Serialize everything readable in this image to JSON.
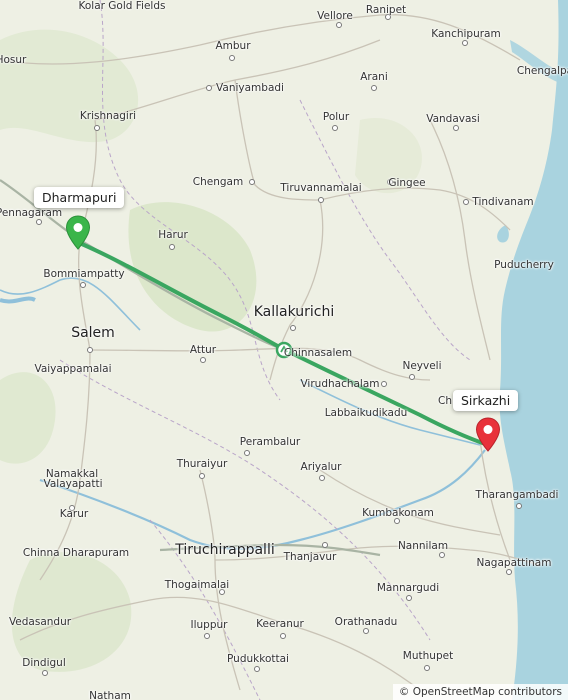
{
  "route": {
    "start": {
      "name": "Dharmapuri",
      "color": "#3ab54a"
    },
    "end": {
      "name": "Sirkazhi",
      "color": "#e8313a"
    },
    "line_color": "#3aa660"
  },
  "places": [
    {
      "id": "kolar-gold-fields",
      "name": "Kolar Gold Fields"
    },
    {
      "id": "vellore",
      "name": "Vellore"
    },
    {
      "id": "ranipet",
      "name": "Ranipet"
    },
    {
      "id": "kanchipuram",
      "name": "Kanchipuram"
    },
    {
      "id": "chengalpattu",
      "name": "Chengalpa"
    },
    {
      "id": "hosur",
      "name": "Hosur"
    },
    {
      "id": "ambur",
      "name": "Ambur"
    },
    {
      "id": "arani",
      "name": "Arani"
    },
    {
      "id": "vaniyambadi",
      "name": "Vaniyambadi"
    },
    {
      "id": "krishnagiri",
      "name": "Krishnagiri"
    },
    {
      "id": "polur",
      "name": "Polur"
    },
    {
      "id": "vandavasi",
      "name": "Vandavasi"
    },
    {
      "id": "chengam",
      "name": "Chengam"
    },
    {
      "id": "tiruvannamalai",
      "name": "Tiruvannamalai"
    },
    {
      "id": "gingee",
      "name": "Gingee"
    },
    {
      "id": "tindivanam",
      "name": "Tindivanam"
    },
    {
      "id": "pennagaram",
      "name": "Pennagaram"
    },
    {
      "id": "harur",
      "name": "Harur"
    },
    {
      "id": "puducherry",
      "name": "Puducherry"
    },
    {
      "id": "bommiampatty",
      "name": "Bommiampatty"
    },
    {
      "id": "kallakurichi",
      "name": "Kallakurichi"
    },
    {
      "id": "salem",
      "name": "Salem"
    },
    {
      "id": "attur",
      "name": "Attur"
    },
    {
      "id": "chinnasalem",
      "name": "Chinnasalem"
    },
    {
      "id": "neyveli",
      "name": "Neyveli"
    },
    {
      "id": "vaiyappamalai",
      "name": "Vaiyappamalai"
    },
    {
      "id": "virudhachalam",
      "name": "Virudhachalam"
    },
    {
      "id": "chidambaram",
      "name": "Ch"
    },
    {
      "id": "labbaikudikadu",
      "name": "Labbaikudikadu"
    },
    {
      "id": "namakkal",
      "name": "Namakkal"
    },
    {
      "id": "perambalur",
      "name": "Perambalur"
    },
    {
      "id": "thuraiyur",
      "name": "Thuraiyur"
    },
    {
      "id": "ariyalur",
      "name": "Ariyalur"
    },
    {
      "id": "velayapatti",
      "name": "Valayapatti"
    },
    {
      "id": "tharangambadi",
      "name": "Tharangambadi"
    },
    {
      "id": "karur",
      "name": "Karur"
    },
    {
      "id": "kumbakonam",
      "name": "Kumbakonam"
    },
    {
      "id": "chinna-dharapuram",
      "name": "Chinna Dharapuram"
    },
    {
      "id": "tiruchirappalli",
      "name": "Tiruchirappalli"
    },
    {
      "id": "thanjavur",
      "name": "Thanjavur"
    },
    {
      "id": "nannilam",
      "name": "Nannilam"
    },
    {
      "id": "nagapattinam",
      "name": "Nagapattinam"
    },
    {
      "id": "thogaimalai",
      "name": "Thogaimalai"
    },
    {
      "id": "mannargudi",
      "name": "Mannargudi"
    },
    {
      "id": "vedasandur",
      "name": "Vedasandur"
    },
    {
      "id": "iluppur",
      "name": "Iluppur"
    },
    {
      "id": "keeranur",
      "name": "Keeranur"
    },
    {
      "id": "orathanadu",
      "name": "Orathanadu"
    },
    {
      "id": "dindigul",
      "name": "Dindigul"
    },
    {
      "id": "pudukkottai",
      "name": "Pudukkottai"
    },
    {
      "id": "muthupet",
      "name": "Muthupet"
    },
    {
      "id": "natham",
      "name": "Natham"
    }
  ],
  "attribution": "© OpenStreetMap contributors"
}
